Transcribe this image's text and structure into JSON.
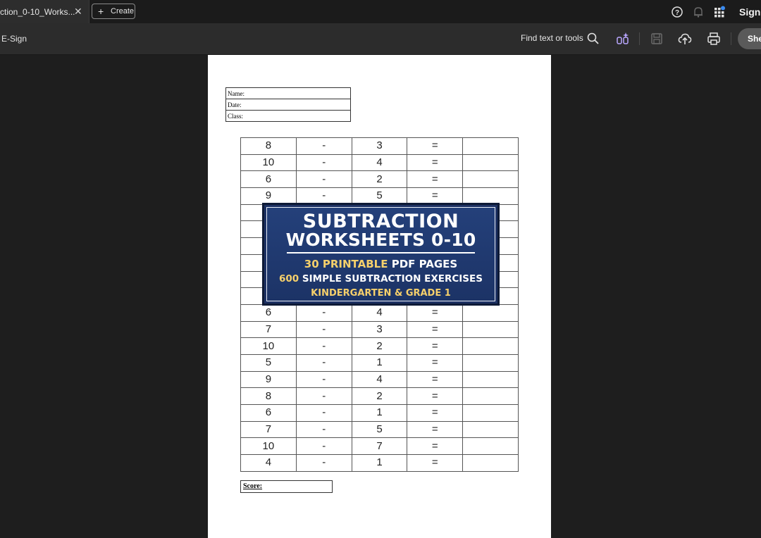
{
  "tab": {
    "title": "ction_0-10_Works...",
    "close": "✕"
  },
  "create_button": {
    "label": "Create",
    "icon": "plus-icon"
  },
  "top_right": {
    "help_icon": "help-icon",
    "bell_icon": "bell-icon",
    "apps_icon": "apps-grid-icon",
    "sign_label": "Sign"
  },
  "toolbar": {
    "esign_label": "E-Sign",
    "find_label": "Find text or tools",
    "search_icon": "search-icon",
    "ai_icon": "ai-assistant-icon",
    "save_icon": "save-icon",
    "upload_icon": "cloud-upload-icon",
    "print_icon": "print-icon",
    "share_label": "She"
  },
  "worksheet": {
    "info_fields": [
      "Name:",
      "Date:",
      "Class:"
    ],
    "problems": [
      {
        "a": "8",
        "op": "-",
        "b": "3",
        "eq": "="
      },
      {
        "a": "10",
        "op": "-",
        "b": "4",
        "eq": "="
      },
      {
        "a": "6",
        "op": "-",
        "b": "2",
        "eq": "="
      },
      {
        "a": "9",
        "op": "-",
        "b": "5",
        "eq": "="
      },
      {
        "a": "",
        "op": "",
        "b": "",
        "eq": ""
      },
      {
        "a": "",
        "op": "",
        "b": "",
        "eq": ""
      },
      {
        "a": "",
        "op": "",
        "b": "",
        "eq": ""
      },
      {
        "a": "",
        "op": "",
        "b": "",
        "eq": ""
      },
      {
        "a": "",
        "op": "",
        "b": "",
        "eq": ""
      },
      {
        "a": "",
        "op": "",
        "b": "",
        "eq": ""
      },
      {
        "a": "6",
        "op": "-",
        "b": "4",
        "eq": "="
      },
      {
        "a": "7",
        "op": "-",
        "b": "3",
        "eq": "="
      },
      {
        "a": "10",
        "op": "-",
        "b": "2",
        "eq": "="
      },
      {
        "a": "5",
        "op": "-",
        "b": "1",
        "eq": "="
      },
      {
        "a": "9",
        "op": "-",
        "b": "4",
        "eq": "="
      },
      {
        "a": "8",
        "op": "-",
        "b": "2",
        "eq": "="
      },
      {
        "a": "6",
        "op": "-",
        "b": "1",
        "eq": "="
      },
      {
        "a": "7",
        "op": "-",
        "b": "5",
        "eq": "="
      },
      {
        "a": "10",
        "op": "-",
        "b": "7",
        "eq": "="
      },
      {
        "a": "4",
        "op": "-",
        "b": "1",
        "eq": "="
      }
    ],
    "score_label": "Score:"
  },
  "banner": {
    "title_line1": "SUBTRACTION",
    "title_line2": "WORKSHEETS 0-10",
    "line3_highlight": "30 PRINTABLE",
    "line3_rest": " PDF PAGES",
    "line4_highlight": "600",
    "line4_rest": " SIMPLE SUBTRACTION EXERCISES",
    "line5": "KINDERGARTEN & GRADE 1",
    "colors": {
      "background": "#1d3163",
      "accent": "#f6d06b",
      "text": "#ffffff"
    }
  }
}
